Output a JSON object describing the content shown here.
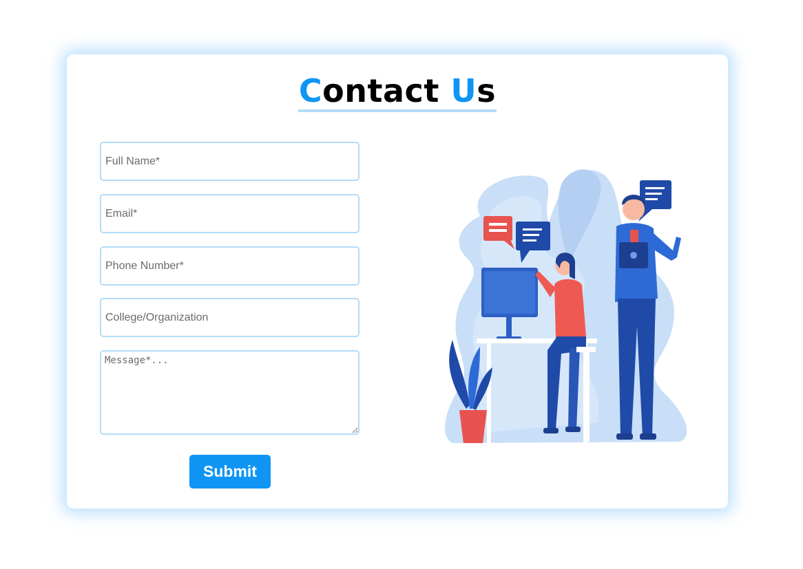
{
  "header": {
    "title_first_letter": "C",
    "title_part1": "ontact ",
    "title_second_letter": "U",
    "title_part2": "s"
  },
  "form": {
    "full_name_placeholder": "Full Name*",
    "email_placeholder": "Email*",
    "phone_placeholder": "Phone Number*",
    "college_placeholder": "College/Organization",
    "message_placeholder": "Message*...",
    "submit_label": "Submit"
  },
  "illustration": {
    "icon": "customer-support-illustration-icon"
  },
  "colors": {
    "accent": "#0f95f3",
    "input_border": "#b3dbf7",
    "card_shadow": "#8cc8fa"
  }
}
